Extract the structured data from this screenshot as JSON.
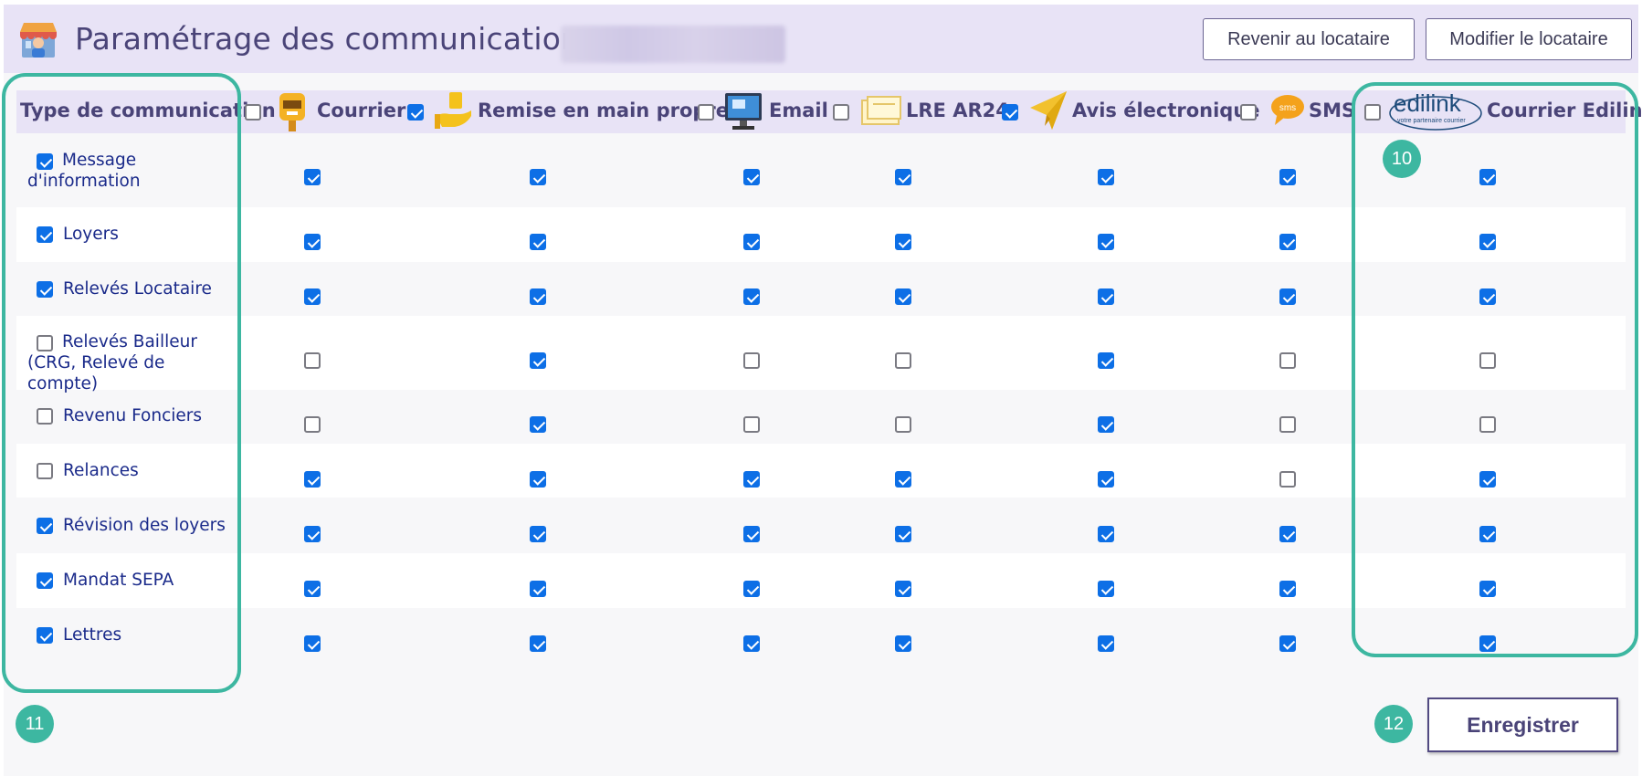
{
  "header": {
    "title": "Paramétrage des communications :",
    "back_button": "Revenir au locataire",
    "edit_button": "Modifier le locataire"
  },
  "table": {
    "type_header": "Type de communication",
    "channels": [
      {
        "key": "courrier",
        "label": "Courrier",
        "icon": "mailbox-icon",
        "header_checked": false
      },
      {
        "key": "remise",
        "label": "Remise en main propre",
        "icon": "hand-delivery-icon",
        "header_checked": true
      },
      {
        "key": "email",
        "label": "Email",
        "icon": "monitor-email-icon",
        "header_checked": false
      },
      {
        "key": "lre",
        "label": "LRE AR24",
        "icon": "envelope-icon",
        "header_checked": false
      },
      {
        "key": "avis",
        "label": "Avis électronique",
        "icon": "paper-plane-icon",
        "header_checked": true
      },
      {
        "key": "sms",
        "label": "SMS",
        "icon": "sms-bubble-icon",
        "header_checked": false
      },
      {
        "key": "edilink",
        "label": "Courrier Edilink",
        "icon": "edilink-logo",
        "header_checked": false
      }
    ],
    "edilink_logo": {
      "name": "edilink",
      "tagline": "votre partenaire courrier"
    },
    "rows": [
      {
        "label": "Message d'information",
        "checked": true,
        "values": [
          true,
          true,
          true,
          true,
          true,
          true,
          true
        ]
      },
      {
        "label": "Loyers",
        "checked": true,
        "values": [
          true,
          true,
          true,
          true,
          true,
          true,
          true
        ]
      },
      {
        "label": "Relevés Locataire",
        "checked": true,
        "values": [
          true,
          true,
          true,
          true,
          true,
          true,
          true
        ]
      },
      {
        "label": "Relevés Bailleur (CRG, Relevé de compte)",
        "checked": false,
        "values": [
          false,
          true,
          false,
          false,
          true,
          false,
          false
        ]
      },
      {
        "label": "Revenu Fonciers",
        "checked": false,
        "values": [
          false,
          true,
          false,
          false,
          true,
          false,
          false
        ]
      },
      {
        "label": "Relances",
        "checked": false,
        "values": [
          true,
          true,
          true,
          true,
          true,
          false,
          true
        ]
      },
      {
        "label": "Révision des loyers",
        "checked": true,
        "values": [
          true,
          true,
          true,
          true,
          true,
          true,
          true
        ]
      },
      {
        "label": "Mandat SEPA",
        "checked": true,
        "values": [
          true,
          true,
          true,
          true,
          true,
          true,
          true
        ]
      },
      {
        "label": "Lettres",
        "checked": true,
        "values": [
          true,
          true,
          true,
          true,
          true,
          true,
          true
        ]
      }
    ]
  },
  "annotations": {
    "marker_10": "10",
    "marker_11": "11",
    "marker_12": "12"
  },
  "save_button": "Enregistrer",
  "colors": {
    "accent": "#4a4478",
    "checkbox": "#0d6fe6",
    "highlight": "#3db7a1",
    "header_bg": "#e8e3f6",
    "row_text": "#1a2a8a"
  }
}
